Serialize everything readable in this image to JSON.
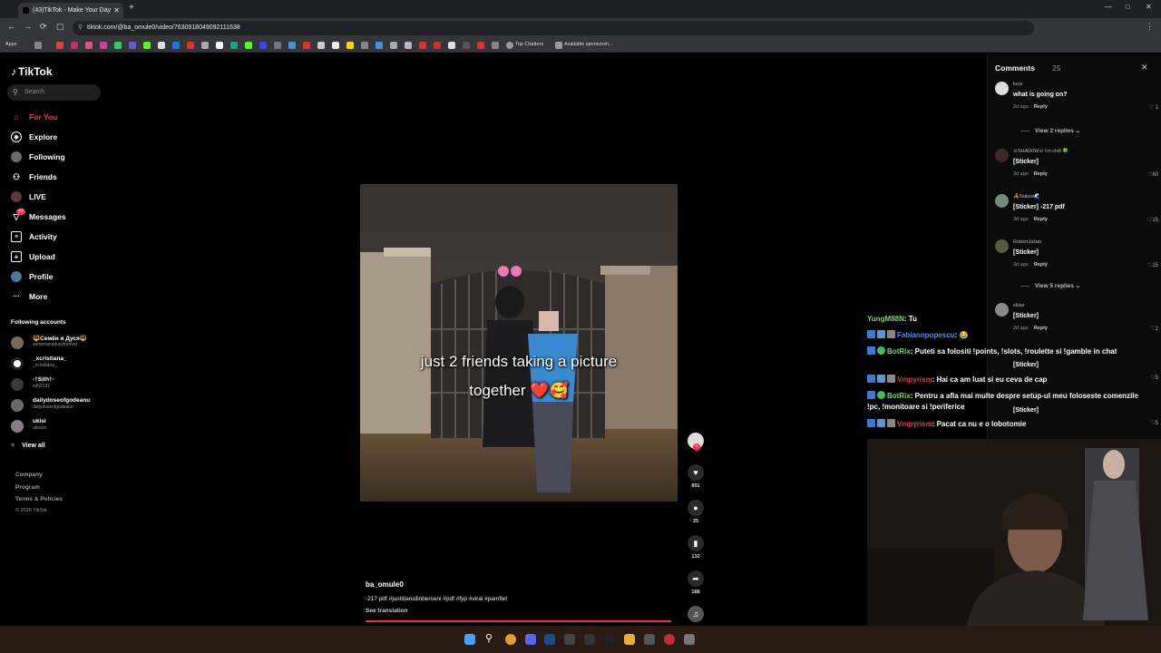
{
  "browser": {
    "tab_title": "(43)TikTok - Make Your Day",
    "url": "tiktok.com/@ba_omule0/video/7630918049092111638",
    "bookmarks": [
      "Apps",
      "Top Chatters",
      "Available sponsorsh..."
    ]
  },
  "sidebar": {
    "logo": "TikTok",
    "search_placeholder": "Search",
    "nav": [
      {
        "label": "For You",
        "icon": "home-icon",
        "active": true
      },
      {
        "label": "Explore",
        "icon": "compass-icon"
      },
      {
        "label": "Following",
        "icon": "following-icon"
      },
      {
        "label": "Friends",
        "icon": "friends-icon"
      },
      {
        "label": "LIVE",
        "icon": "live-icon"
      },
      {
        "label": "Messages",
        "icon": "messages-icon",
        "badge": "43"
      },
      {
        "label": "Activity",
        "icon": "activity-icon"
      },
      {
        "label": "Upload",
        "icon": "upload-icon"
      },
      {
        "label": "Profile",
        "icon": "profile-icon"
      },
      {
        "label": "More",
        "icon": "more-icon"
      }
    ],
    "following_heading": "Following accounts",
    "accounts": [
      {
        "name": "🔱Семён и Дуся🔱",
        "user": "semenanddusyforever"
      },
      {
        "name": "_xcristiana_",
        "user": "_xcristiana_"
      },
      {
        "name": "-†Sith†-",
        "user": "sith2197"
      },
      {
        "name": "dailydoseofgodeanu",
        "user": "dailydoseofgodeanu"
      },
      {
        "name": "ukisi",
        "user": "ukisiss"
      }
    ],
    "view_all": "View all",
    "footer": [
      "Company",
      "Program",
      "Terms & Policies",
      "© 2026 TikTok"
    ]
  },
  "video": {
    "caption_line1": "just 2 friends taking a picture",
    "caption_line2": "together ❤️🥰",
    "username": "ba_omule0",
    "description": "-217 pdf #justițiarudinberceni #pdf #fyp #viral #pamflet",
    "see_translation": "See translation",
    "progress": 0.99
  },
  "actions": {
    "likes": "891",
    "comments": "25",
    "saves": "132",
    "shares": "188"
  },
  "comments_panel": {
    "title": "Comments",
    "count": "25",
    "items": [
      {
        "user": "luca",
        "text": "what is going on?",
        "meta": "2d ago",
        "reply": "Reply",
        "likes": "1"
      },
      {
        "user": "☠SHAD0W☠ i'm chill 🍀",
        "text": "[Sticker]",
        "meta": "3d ago",
        "reply": "Reply",
        "likes": "60"
      },
      {
        "user": "🦂Nature🌊",
        "text": "[Sticker] -217 pdf",
        "meta": "3d ago",
        "reply": "Reply",
        "likes": "15"
      },
      {
        "user": "RobertJulian",
        "text": "[Sticker]",
        "meta": "3d ago",
        "reply": "Reply",
        "likes": "15"
      },
      {
        "user": "skiaz",
        "text": "[Sticker]",
        "meta": "2d ago",
        "reply": "Reply",
        "likes": "2"
      },
      {
        "user": "",
        "text": "[Sticker]",
        "meta": "",
        "reply": "",
        "likes": "5"
      },
      {
        "user": "",
        "text": "[Sticker]",
        "meta": "",
        "reply": "",
        "likes": "5"
      }
    ],
    "view_replies_1": "View 2 replies",
    "view_replies_2": "View 5 replies"
  },
  "stream_chat": [
    {
      "user": "YungM88N",
      "color": "#7bd37b",
      "text": "Tu"
    },
    {
      "user": "Fabiannpopescu",
      "color": "#4a8cff",
      "text": "😂"
    },
    {
      "user": "BotRix",
      "color": "#7bd37b",
      "text": "Puteti sa folositi !points, !slots, !roulette si !gamble in chat"
    },
    {
      "user": "Vmpyrism",
      "color": "#e03a3a",
      "text": "Hai ca am luat si eu ceva de cap"
    },
    {
      "user": "BotRix",
      "color": "#7bd37b",
      "text": "Pentru a afla mai multe despre setup-ul meu foloseste comenzile !pc, !monitoare si !periferice"
    },
    {
      "user": "Vmpyrism",
      "color": "#e03a3a",
      "text": "Pacat ca nu e o lobotomie"
    }
  ],
  "colors": {
    "accent": "#fe2c55",
    "background": "#000000"
  }
}
